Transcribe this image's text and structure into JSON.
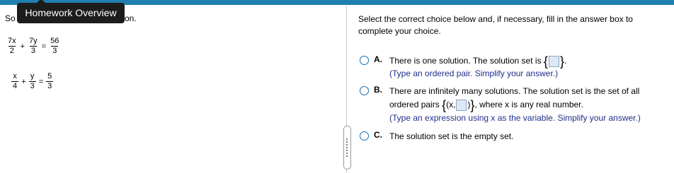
{
  "tooltip": {
    "label": "Homework Overview"
  },
  "behind_left": "So",
  "behind_right": "on.",
  "equations": [
    {
      "t1n": "7x",
      "t1d": "2",
      "op": "+",
      "t2n": "7y",
      "t2d": "3",
      "eq": "=",
      "rn": "56",
      "rd": "3"
    },
    {
      "t1n": "x",
      "t1d": "4",
      "op": "+",
      "t2n": "y",
      "t2d": "3",
      "eq": "=",
      "rn": "5",
      "rd": "3"
    }
  ],
  "instructions": "Select the correct choice below and, if necessary, fill in the answer box to complete your choice.",
  "choices": {
    "a": {
      "letter": "A.",
      "text_before": "There is one solution. The solution set is",
      "hint": "(Type an ordered pair. Simplify your answer.)"
    },
    "b": {
      "letter": "B.",
      "line1": "There are infinitely many solutions. The solution set is the set of all",
      "line2_before": "ordered pairs",
      "pair_prefix": "(x,",
      "line2_after": ", where x is any real number.",
      "hint": "(Type an expression using x as the variable. Simplify your answer.)"
    },
    "c": {
      "letter": "C.",
      "text": "The solution set is the empty set."
    }
  }
}
